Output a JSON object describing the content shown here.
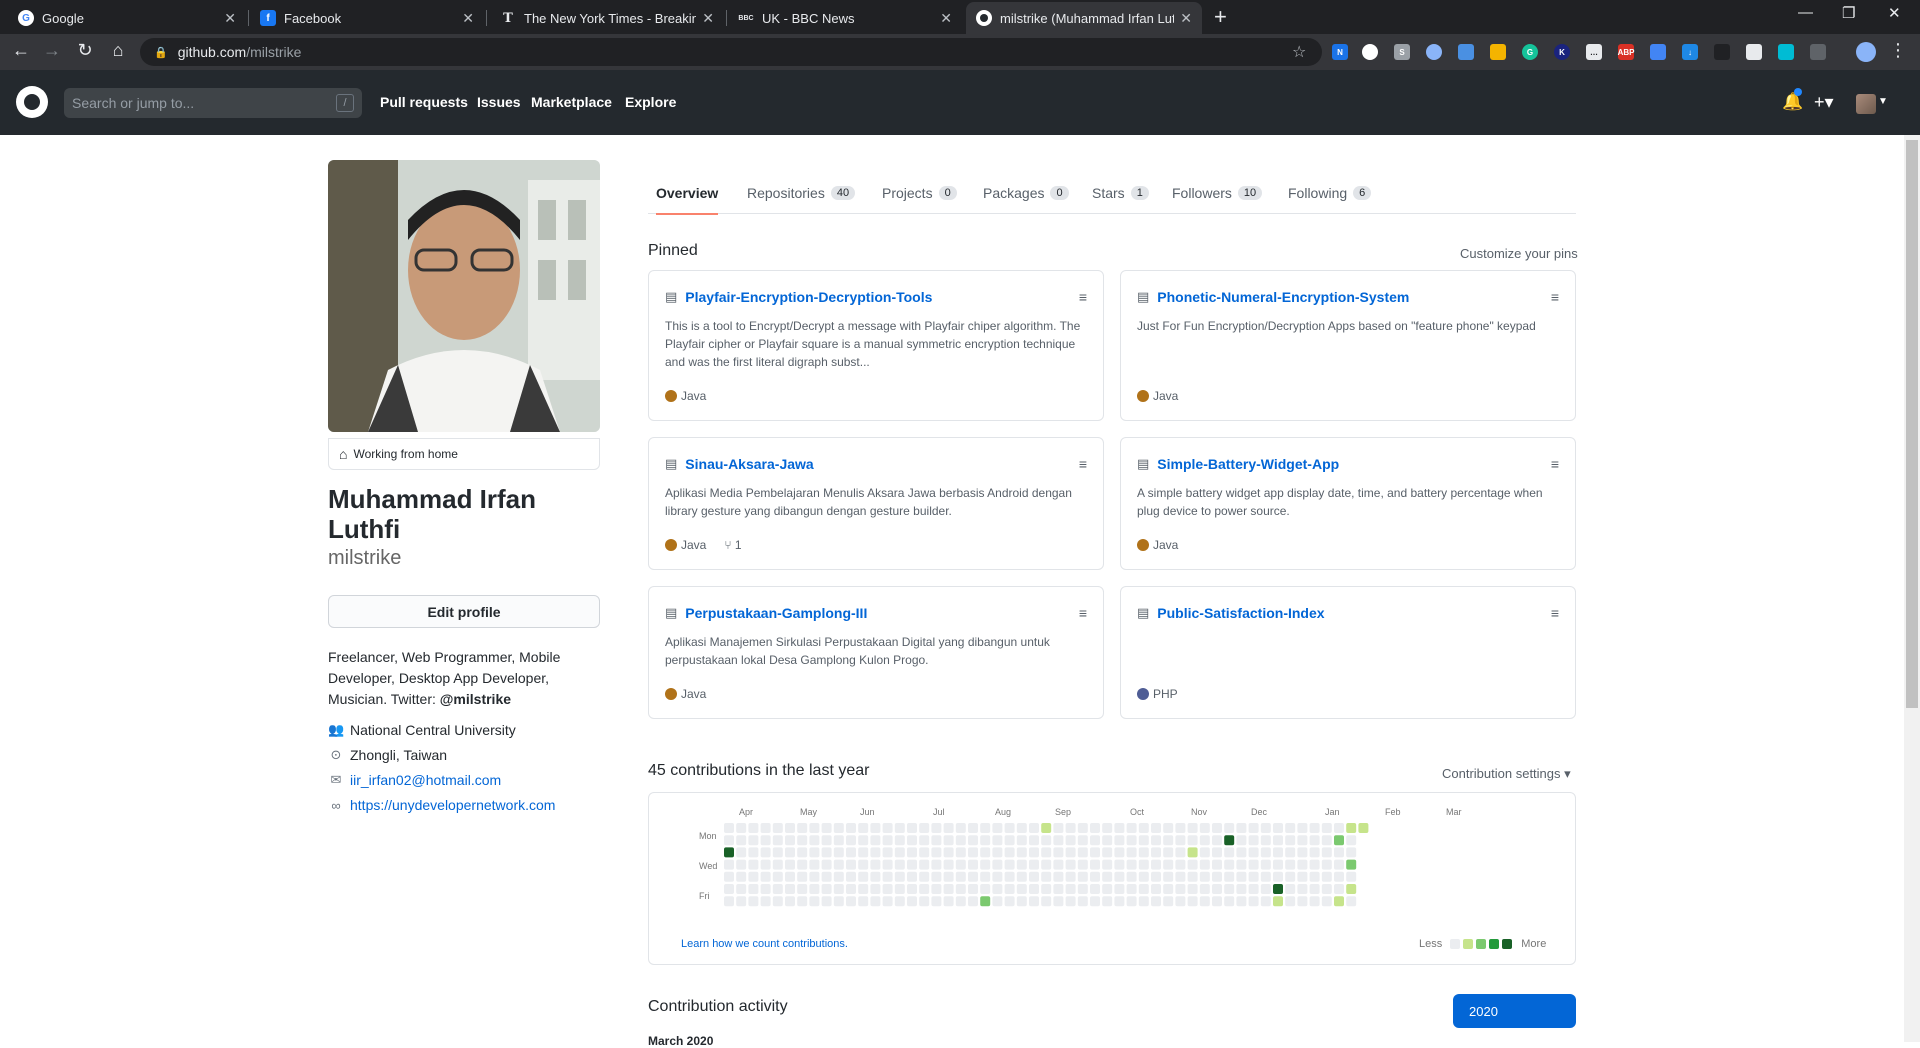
{
  "browser": {
    "tabs": [
      {
        "title": "Google",
        "favicon": "google-g",
        "fav_color": "#ffffff",
        "fav_text": "G",
        "fav_fg": "#4285f4"
      },
      {
        "title": "Facebook",
        "favicon": "facebook-f",
        "fav_color": "#1877f2",
        "fav_text": "f",
        "fav_fg": "#ffffff"
      },
      {
        "title": "The New York Times - Breaking N",
        "favicon": "nyt-t",
        "fav_color": "#202124",
        "fav_text": "T",
        "fav_fg": "#e8eaed"
      },
      {
        "title": "UK - BBC News",
        "favicon": "bbc-logo",
        "fav_color": "#202124",
        "fav_text": "BBC",
        "fav_fg": "#e8eaed"
      },
      {
        "title": "milstrike (Muhammad Irfan Luthf",
        "favicon": "github-octocat",
        "fav_color": "#ffffff",
        "fav_text": "",
        "fav_fg": "#24292e"
      }
    ],
    "url_domain": "github.com",
    "url_path": "/milstrike"
  },
  "github_header": {
    "search_placeholder": "Search or jump to...",
    "slash_hint": "/",
    "nav": [
      "Pull requests",
      "Issues",
      "Marketplace",
      "Explore"
    ]
  },
  "profile": {
    "status": "Working from home",
    "full_name": "Muhammad Irfan Luthfi",
    "username": "milstrike",
    "edit_profile": "Edit profile",
    "bio_text": "Freelancer, Web Programmer, Mobile Developer, Desktop App Developer, Musician. Twitter: ",
    "bio_handle": "@milstrike",
    "organization": "National Central University",
    "location": "Zhongli, Taiwan",
    "email": "iir_irfan02@hotmail.com",
    "website": "https://unydevelopernetwork.com"
  },
  "profile_tabs": [
    {
      "label": "Overview",
      "count": ""
    },
    {
      "label": "Repositories",
      "count": "40"
    },
    {
      "label": "Projects",
      "count": "0"
    },
    {
      "label": "Packages",
      "count": "0"
    },
    {
      "label": "Stars",
      "count": "1"
    },
    {
      "label": "Followers",
      "count": "10"
    },
    {
      "label": "Following",
      "count": "6"
    }
  ],
  "pinned": {
    "heading": "Pinned",
    "customize": "Customize your pins",
    "repos": [
      {
        "name": "Playfair-Encryption-Decryption-Tools",
        "description": "This is a tool to Encrypt/Decrypt a message with Playfair chiper algorithm. The Playfair cipher or Playfair square is a manual symmetric encryption technique and was the first literal digraph subst...",
        "language": "Java",
        "lang_color": "#b07219",
        "forks": ""
      },
      {
        "name": "Phonetic-Numeral-Encryption-System",
        "description": "Just For Fun Encryption/Decryption Apps based on \"feature phone\" keypad",
        "language": "Java",
        "lang_color": "#b07219",
        "forks": ""
      },
      {
        "name": "Sinau-Aksara-Jawa",
        "description": "Aplikasi Media Pembelajaran Menulis Aksara Jawa berbasis Android dengan library gesture yang dibangun dengan gesture builder.",
        "language": "Java",
        "lang_color": "#b07219",
        "forks": "1"
      },
      {
        "name": "Simple-Battery-Widget-App",
        "description": "A simple battery widget app display date, time, and battery percentage when plug device to power source.",
        "language": "Java",
        "lang_color": "#b07219",
        "forks": ""
      },
      {
        "name": "Perpustakaan-Gamplong-III",
        "description": "Aplikasi Manajemen Sirkulasi Perpustakaan Digital yang dibangun untuk perpustakaan lokal Desa Gamplong Kulon Progo.",
        "language": "Java",
        "lang_color": "#b07219",
        "forks": ""
      },
      {
        "name": "Public-Satisfaction-Index",
        "description": "",
        "language": "PHP",
        "lang_color": "#4F5D95",
        "forks": ""
      }
    ]
  },
  "contributions": {
    "heading": "45 contributions in the last year",
    "settings": "Contribution settings ▾",
    "months": [
      "Apr",
      "May",
      "Jun",
      "Jul",
      "Aug",
      "Sep",
      "Oct",
      "Nov",
      "Dec",
      "Jan",
      "Feb",
      "Mar"
    ],
    "days": [
      "Mon",
      "Wed",
      "Fri"
    ],
    "learn": "Learn how we count contributions.",
    "legend_less": "Less",
    "legend_more": "More",
    "colors": [
      "#ebedf0",
      "#c6e48b",
      "#7bc96f",
      "#239a3b",
      "#196127"
    ],
    "active_cells": [
      {
        "week": 0,
        "day": 2,
        "level": 4
      },
      {
        "week": 21,
        "day": 6,
        "level": 2
      },
      {
        "week": 26,
        "day": 0,
        "level": 1
      },
      {
        "week": 38,
        "day": 2,
        "level": 1
      },
      {
        "week": 41,
        "day": 1,
        "level": 4
      },
      {
        "week": 45,
        "day": 5,
        "level": 4
      },
      {
        "week": 45,
        "day": 6,
        "level": 1
      },
      {
        "week": 50,
        "day": 1,
        "level": 2
      },
      {
        "week": 50,
        "day": 6,
        "level": 1
      },
      {
        "week": 51,
        "day": 0,
        "level": 1
      },
      {
        "week": 51,
        "day": 3,
        "level": 2
      },
      {
        "week": 51,
        "day": 5,
        "level": 1
      },
      {
        "week": 52,
        "day": 0,
        "level": 1
      }
    ]
  },
  "activity": {
    "heading": "Contribution activity",
    "year": "2020",
    "first_month": "March 2020"
  }
}
